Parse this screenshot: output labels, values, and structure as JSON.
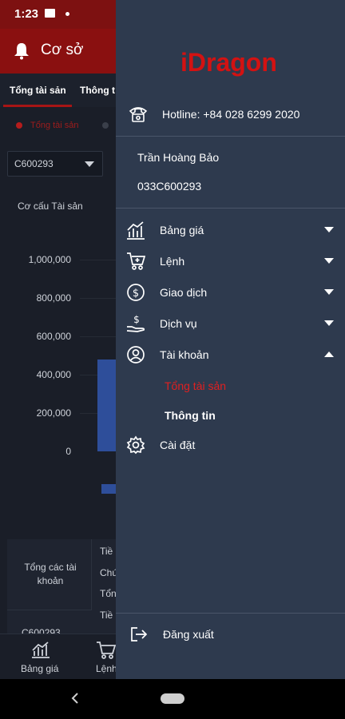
{
  "status_bar": {
    "time": "1:23"
  },
  "background_app": {
    "header_title": "Cơ sở",
    "tabs": [
      "Tổng tài sản",
      "Thông t"
    ],
    "subtab_selected": "Tổng tài sản",
    "account_select": {
      "value": "C600293"
    },
    "section_title": "Cơ cấu Tài sản",
    "chart_data": {
      "type": "bar",
      "y_ticks": [
        "1,000,000",
        "800,000",
        "600,000",
        "400,000",
        "200,000",
        "0"
      ],
      "ylim": [
        0,
        1000000
      ],
      "values": [
        480000,
        -20000
      ]
    },
    "table": {
      "group_label": "Tổng các tài khoản",
      "row_labels": [
        "Tiề",
        "Chứ",
        "Tổn",
        "Tiề"
      ],
      "account_partial": "C600293"
    },
    "bottom_nav": [
      "Bảng giá",
      "Lệnh"
    ]
  },
  "drawer": {
    "logo": "iDragon",
    "hotline": "Hotline: +84 028 6299 2020",
    "user_name": "Trần Hoàng Bảo",
    "user_code": "033C600293",
    "menu": [
      {
        "label": "Bảng giá",
        "icon": "chart-icon",
        "expanded": false
      },
      {
        "label": "Lệnh",
        "icon": "cart-icon",
        "expanded": false
      },
      {
        "label": "Giao dịch",
        "icon": "dollar-icon",
        "expanded": false
      },
      {
        "label": "Dịch vụ",
        "icon": "service-icon",
        "expanded": false
      },
      {
        "label": "Tài khoản",
        "icon": "user-icon",
        "expanded": true
      }
    ],
    "submenu": [
      {
        "label": "Tổng tài sản",
        "active": true
      },
      {
        "label": "Thông tin",
        "active": false
      }
    ],
    "settings": "Cài đặt",
    "logout": "Đăng xuất"
  },
  "colors": {
    "brand_red": "#d31212",
    "drawer_bg": "#2e3a4e",
    "active_sub": "#e02020"
  }
}
